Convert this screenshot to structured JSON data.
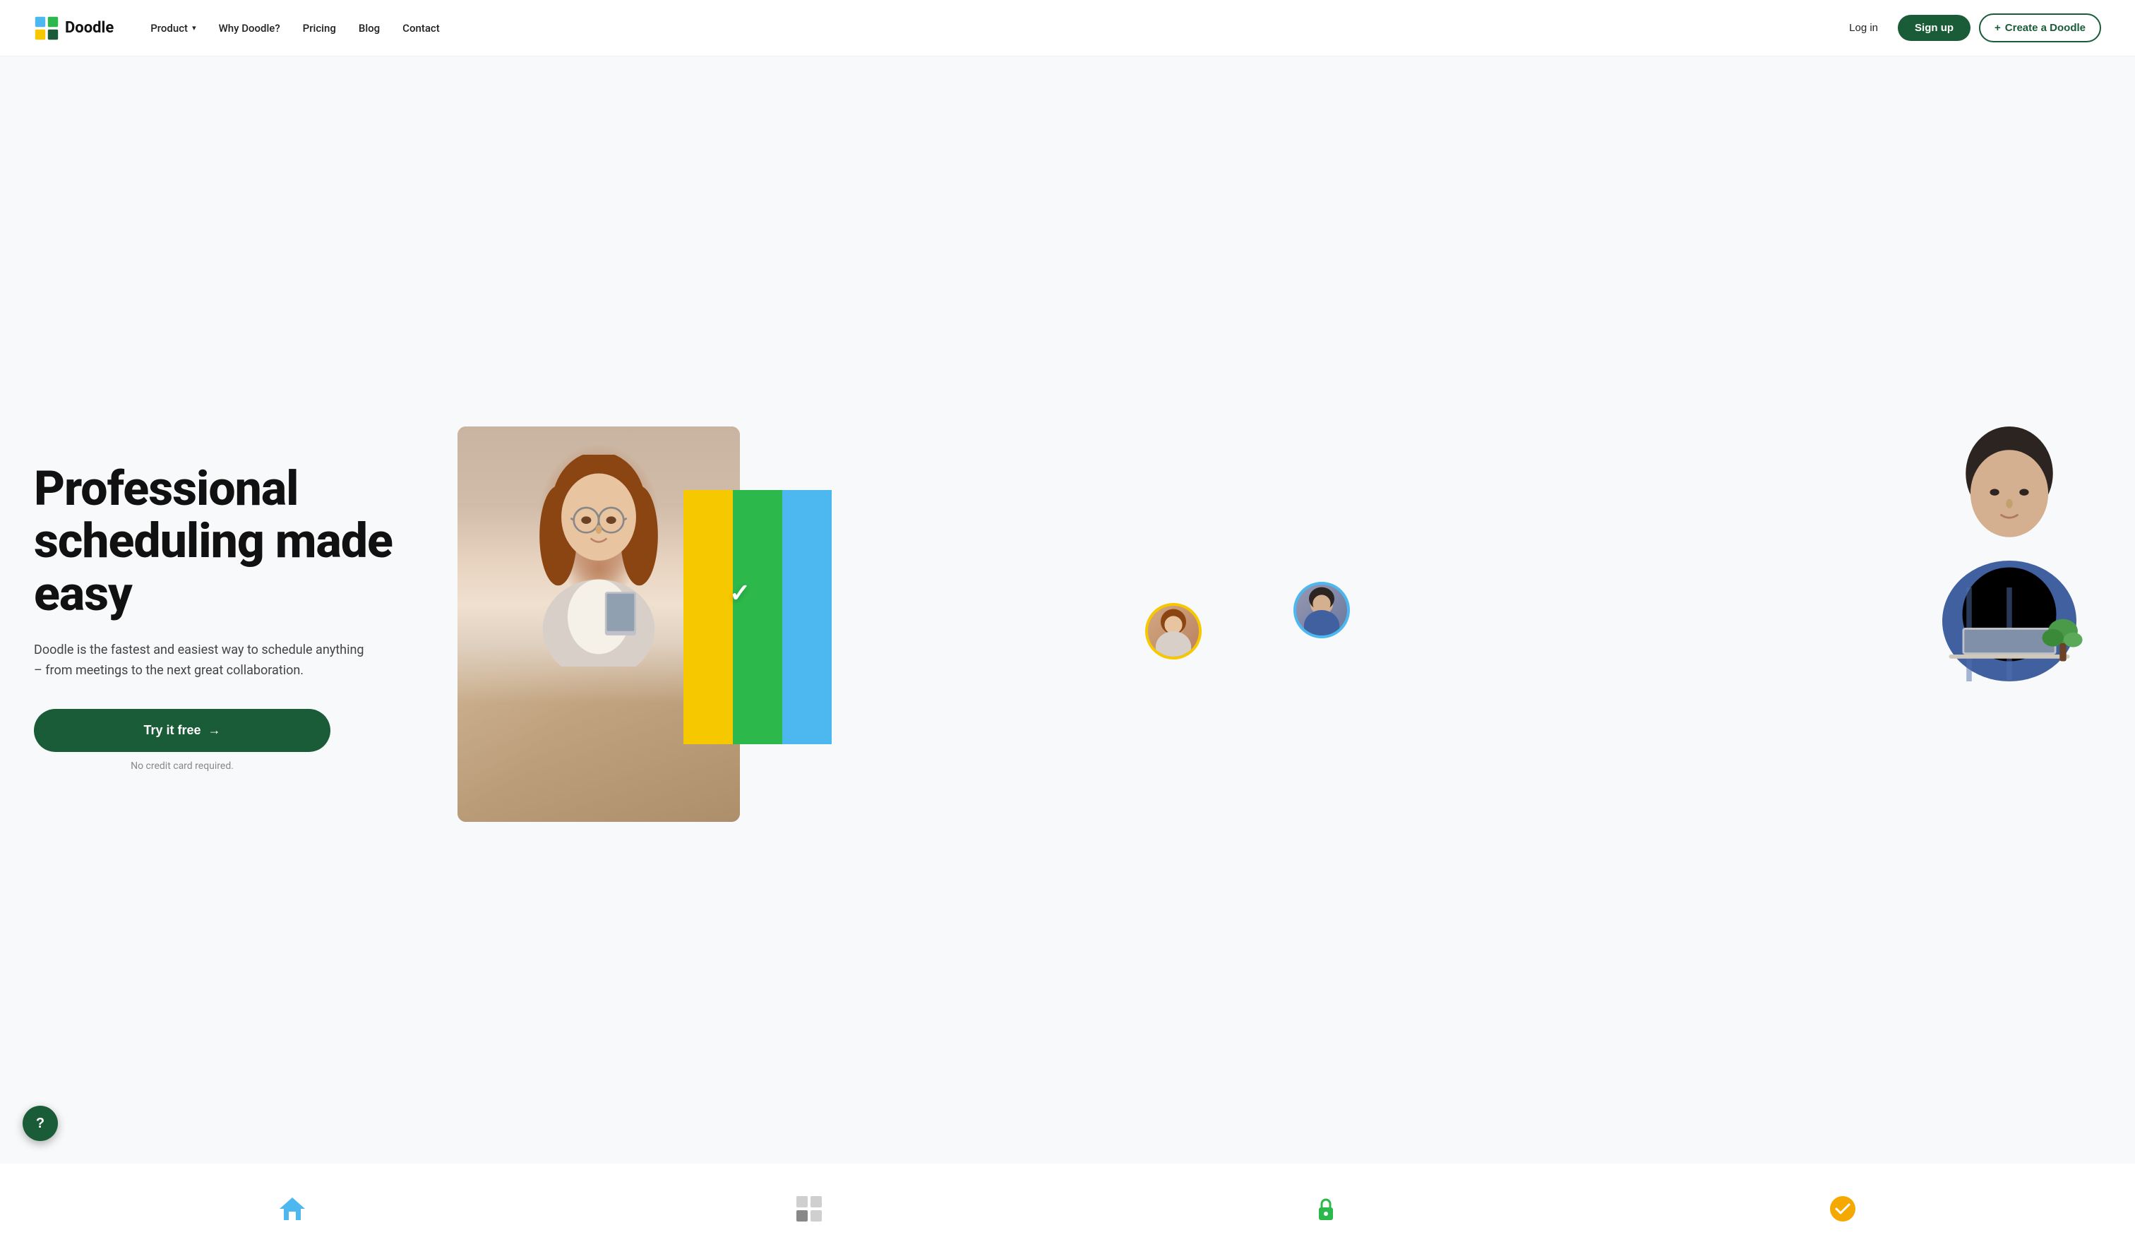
{
  "brand": {
    "name": "Doodle",
    "logo_alt": "Doodle logo"
  },
  "navbar": {
    "links": [
      {
        "label": "Product",
        "has_dropdown": true
      },
      {
        "label": "Why Doodle?",
        "has_dropdown": false
      },
      {
        "label": "Pricing",
        "has_dropdown": false
      },
      {
        "label": "Blog",
        "has_dropdown": false
      },
      {
        "label": "Contact",
        "has_dropdown": false
      }
    ],
    "login_label": "Log in",
    "signup_label": "Sign up",
    "create_label": "Create a Doodle",
    "create_prefix": "+"
  },
  "hero": {
    "title": "Professional scheduling made easy",
    "subtitle": "Doodle is the fastest and easiest way to schedule anything – from meetings to the next great collaboration.",
    "cta_label": "Try it free",
    "cta_arrow": "→",
    "no_credit": "No credit card required."
  },
  "bottom_icons": [
    {
      "icon": "🏠",
      "color": "#4db8f0"
    },
    {
      "icon": "⊞",
      "color": "#888"
    },
    {
      "icon": "🔒",
      "color": "#2db84b"
    },
    {
      "icon": "✓",
      "color": "#f5a800"
    }
  ],
  "help": {
    "label": "?"
  },
  "colors": {
    "primary_green": "#1a5c38",
    "bar_yellow": "#f5c800",
    "bar_green": "#2db84b",
    "bar_blue": "#4db8f0"
  }
}
